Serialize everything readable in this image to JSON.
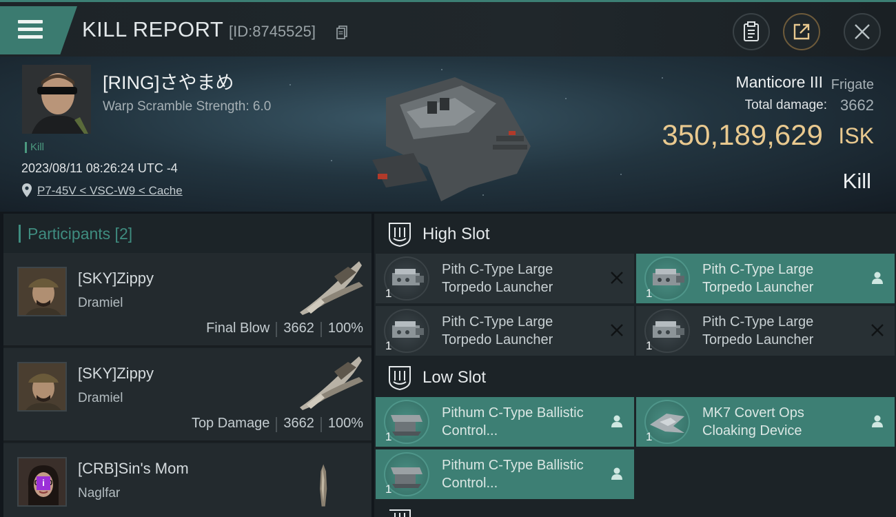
{
  "header": {
    "title": "KILL REPORT",
    "report_id": "[ID:8745525]"
  },
  "victim": {
    "name": "[RING]さやまめ",
    "warp_scramble": "Warp Scramble Strength: 6.0",
    "tag": "Kill",
    "timestamp": "2023/08/11 08:26:24 UTC -4",
    "location": "P7-45V < VSC-W9 < Cache",
    "ship_name": "Manticore III",
    "ship_class": "Frigate",
    "total_damage_label": "Total damage:",
    "total_damage": "3662",
    "isk_value": "350,189,629",
    "isk_unit": "ISK",
    "result": "Kill"
  },
  "participants": {
    "title": "Participants [2]",
    "items": [
      {
        "name": "[SKY]Zippy",
        "ship": "Dramiel",
        "role": "Final Blow",
        "damage": "3662",
        "percent": "100%"
      },
      {
        "name": "[SKY]Zippy",
        "ship": "Dramiel",
        "role": "Top Damage",
        "damage": "3662",
        "percent": "100%"
      },
      {
        "name": "[CRB]Sin's Mom",
        "ship": "Naglfar",
        "badge": "i"
      }
    ]
  },
  "fittings": {
    "high_slot": {
      "title": "High Slot",
      "modules": [
        {
          "name": "Pith C-Type Large Torpedo Launcher",
          "qty": "1",
          "status": "destroyed"
        },
        {
          "name": "Pith C-Type Large Torpedo Launcher",
          "qty": "1",
          "status": "dropped"
        },
        {
          "name": "Pith C-Type Large Torpedo Launcher",
          "qty": "1",
          "status": "destroyed"
        },
        {
          "name": "Pith C-Type Large Torpedo Launcher",
          "qty": "1",
          "status": "destroyed"
        }
      ]
    },
    "low_slot": {
      "title": "Low Slot",
      "modules": [
        {
          "name": "Pithum C-Type Ballistic Control...",
          "qty": "1",
          "status": "dropped"
        },
        {
          "name": "MK7 Covert Ops Cloaking Device",
          "qty": "1",
          "status": "dropped"
        },
        {
          "name": "Pithum C-Type Ballistic Control...",
          "qty": "1",
          "status": "dropped"
        }
      ]
    }
  },
  "colors": {
    "accent": "#3d7f74",
    "isk": "#e9c98f",
    "badge": "#9b30d8"
  }
}
